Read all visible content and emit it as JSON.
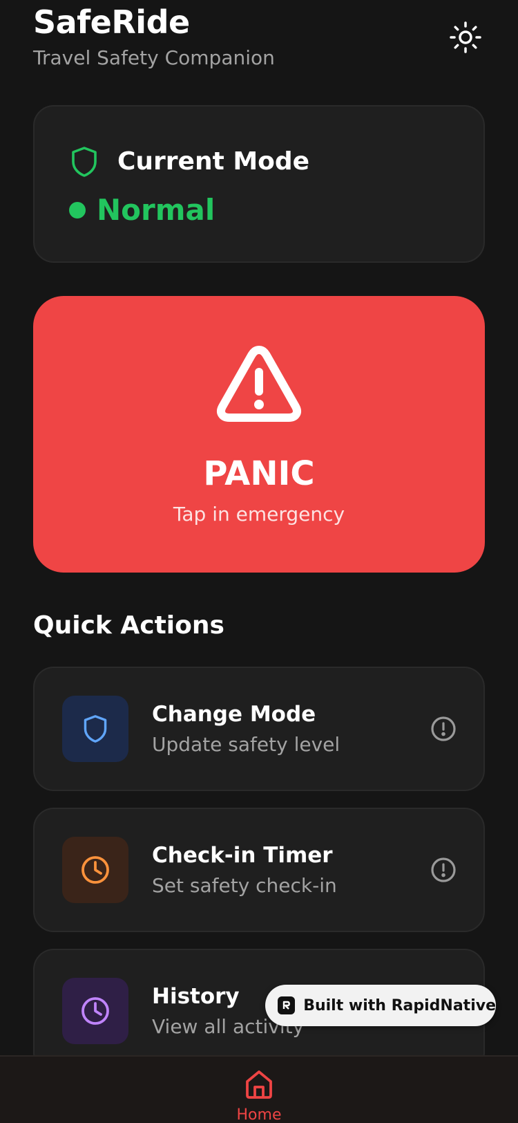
{
  "header": {
    "title": "SafeRide",
    "subtitle": "Travel Safety Companion",
    "theme_icon": "sun-icon"
  },
  "mode_card": {
    "title": "Current Mode",
    "value": "Normal",
    "icon": "shield-icon",
    "status_color": "#22c55e"
  },
  "panic": {
    "title": "PANIC",
    "subtitle": "Tap in emergency",
    "icon": "warning-triangle-icon",
    "color": "#ef4545"
  },
  "quick_actions": {
    "title": "Quick Actions",
    "items": [
      {
        "title": "Change Mode",
        "subtitle": "Update safety level",
        "icon": "shield-icon",
        "accent": "#60a5fa"
      },
      {
        "title": "Check-in Timer",
        "subtitle": "Set safety check-in",
        "icon": "clock-icon",
        "accent": "#fb923c"
      },
      {
        "title": "History",
        "subtitle": "View all activity",
        "icon": "clock-icon",
        "accent": "#c084fc"
      }
    ]
  },
  "badge": {
    "text": "Built with RapidNative"
  },
  "tabbar": {
    "home_label": "Home",
    "active_color": "#ef4444"
  }
}
